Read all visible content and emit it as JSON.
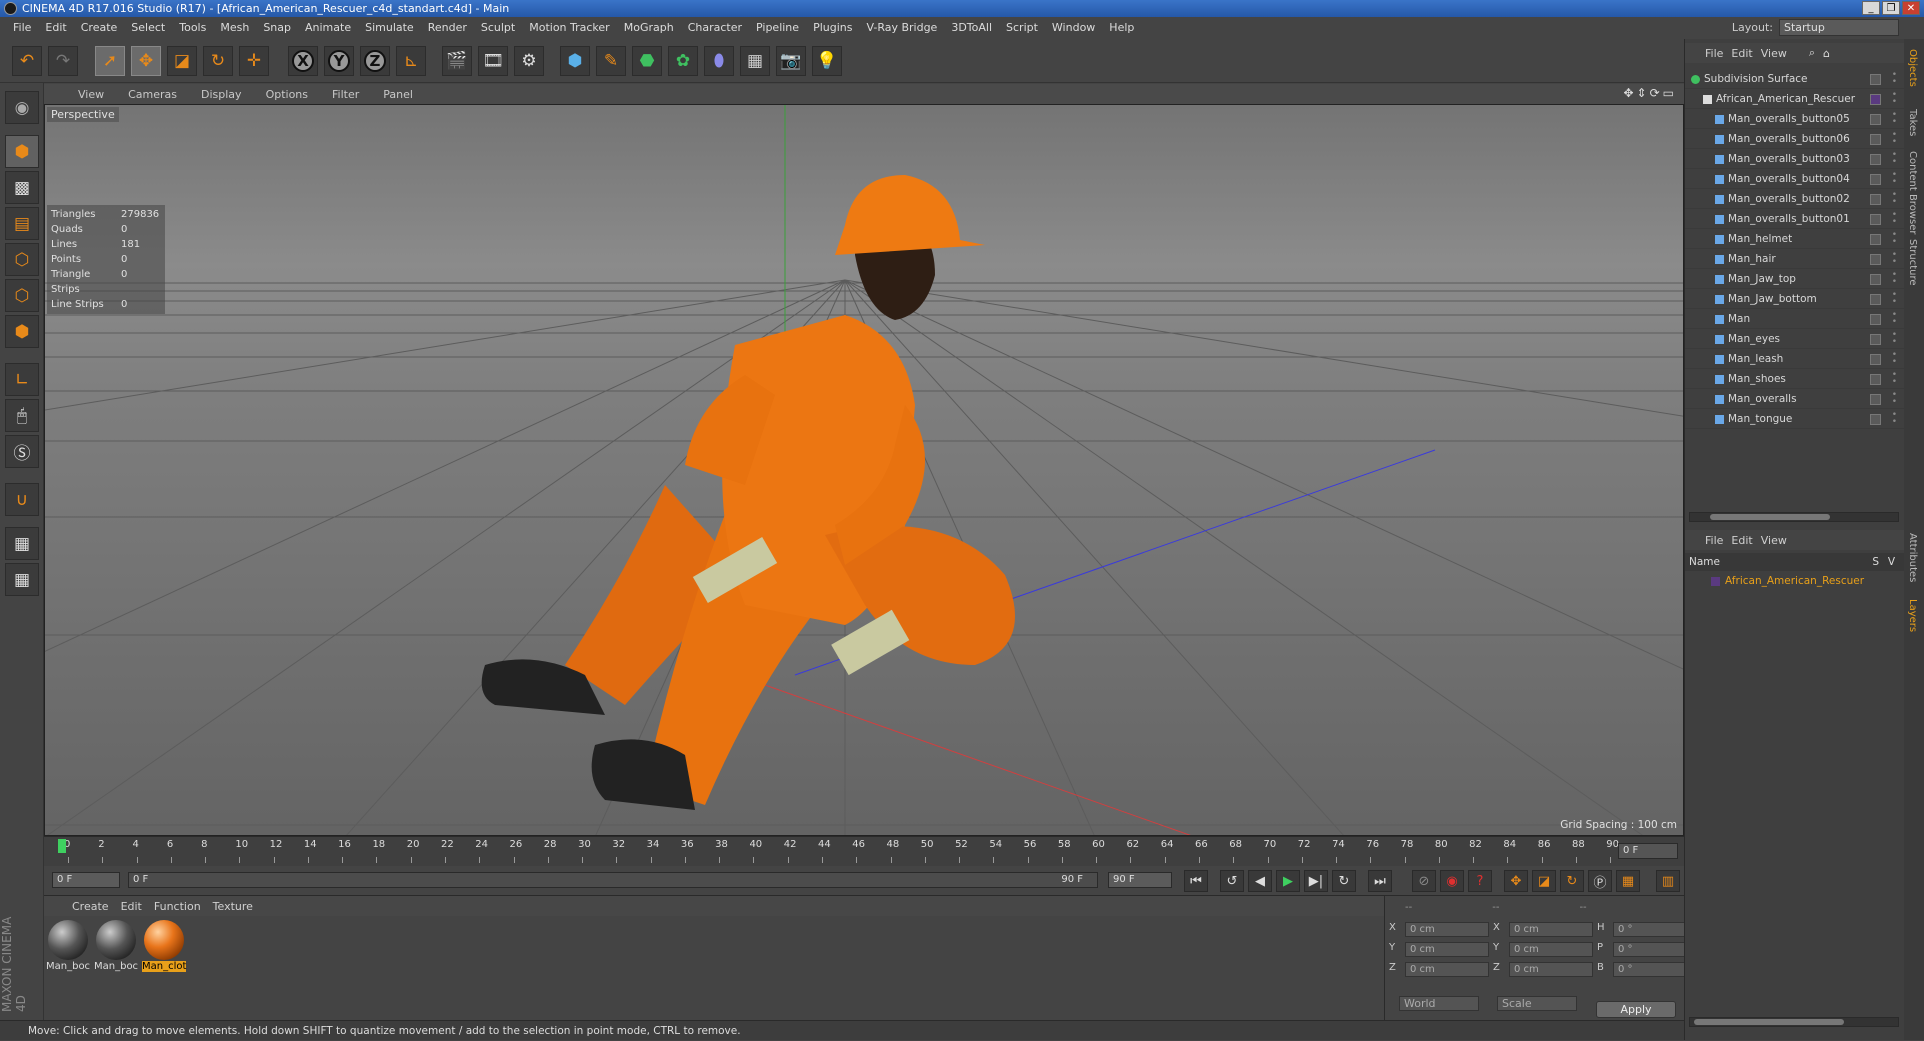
{
  "window": {
    "title": "CINEMA 4D R17.016 Studio (R17) - [African_American_Rescuer_c4d_standart.c4d] - Main"
  },
  "menubar": [
    "File",
    "Edit",
    "Create",
    "Select",
    "Tools",
    "Mesh",
    "Snap",
    "Animate",
    "Simulate",
    "Render",
    "Sculpt",
    "Motion Tracker",
    "MoGraph",
    "Character",
    "Pipeline",
    "Plugins",
    "V-Ray Bridge",
    "3DToAll",
    "Script",
    "Window",
    "Help"
  ],
  "layout": {
    "label": "Layout:",
    "value": "Startup"
  },
  "viewport": {
    "menu": [
      "View",
      "Cameras",
      "Display",
      "Options",
      "Filter",
      "Panel"
    ],
    "camera_label": "Perspective",
    "stats": [
      {
        "k": "Triangles",
        "v": "279836"
      },
      {
        "k": "Quads",
        "v": "0"
      },
      {
        "k": "Lines",
        "v": "181"
      },
      {
        "k": "Points",
        "v": "0"
      },
      {
        "k": "Triangle Strips",
        "v": "0"
      },
      {
        "k": "Line Strips",
        "v": "0"
      }
    ],
    "grid_spacing": "Grid Spacing : 100 cm"
  },
  "timeline": {
    "ticks": [
      "0",
      "2",
      "4",
      "6",
      "8",
      "10",
      "12",
      "14",
      "16",
      "18",
      "20",
      "22",
      "24",
      "26",
      "28",
      "30",
      "32",
      "34",
      "36",
      "38",
      "40",
      "42",
      "44",
      "46",
      "48",
      "50",
      "52",
      "54",
      "56",
      "58",
      "60",
      "62",
      "64",
      "66",
      "68",
      "70",
      "72",
      "74",
      "76",
      "78",
      "80",
      "82",
      "84",
      "86",
      "88",
      "90"
    ],
    "current_frame": "0 F",
    "start_frame": "0 F",
    "range_start": "0 F",
    "range_end": "90 F",
    "end_frame": "90 F"
  },
  "materials": {
    "menu": [
      "Create",
      "Edit",
      "Function",
      "Texture"
    ],
    "items": [
      {
        "label": "Man_boc",
        "selected": false
      },
      {
        "label": "Man_boc",
        "selected": false
      },
      {
        "label": "Man_clot",
        "selected": true
      }
    ]
  },
  "coords": {
    "headers": [
      "--",
      "--",
      "--"
    ],
    "rows": [
      {
        "a": "X",
        "av": "0 cm",
        "b": "X",
        "bv": "0 cm",
        "c": "H",
        "cv": "0 °"
      },
      {
        "a": "Y",
        "av": "0 cm",
        "b": "Y",
        "bv": "0 cm",
        "c": "P",
        "cv": "0 °"
      },
      {
        "a": "Z",
        "av": "0 cm",
        "b": "Z",
        "bv": "0 cm",
        "c": "B",
        "cv": "0 °"
      }
    ],
    "world": "World",
    "scale": "Scale",
    "apply": "Apply"
  },
  "statusbar": "Move: Click and drag to move elements. Hold down SHIFT to quantize movement / add to the selection in point mode, CTRL to remove.",
  "objects": {
    "menu": [
      "File",
      "Edit",
      "View"
    ],
    "items": [
      {
        "label": "Subdivision Surface",
        "indent": 0
      },
      {
        "label": "African_American_Rescuer",
        "indent": 1
      },
      {
        "label": "Man_overalls_button05",
        "indent": 2
      },
      {
        "label": "Man_overalls_button06",
        "indent": 2
      },
      {
        "label": "Man_overalls_button03",
        "indent": 2
      },
      {
        "label": "Man_overalls_button04",
        "indent": 2
      },
      {
        "label": "Man_overalls_button02",
        "indent": 2
      },
      {
        "label": "Man_overalls_button01",
        "indent": 2
      },
      {
        "label": "Man_helmet",
        "indent": 2
      },
      {
        "label": "Man_hair",
        "indent": 2
      },
      {
        "label": "Man_Jaw_top",
        "indent": 2
      },
      {
        "label": "Man_Jaw_bottom",
        "indent": 2
      },
      {
        "label": "Man",
        "indent": 2
      },
      {
        "label": "Man_eyes",
        "indent": 2
      },
      {
        "label": "Man_leash",
        "indent": 2
      },
      {
        "label": "Man_shoes",
        "indent": 2
      },
      {
        "label": "Man_overalls",
        "indent": 2
      },
      {
        "label": "Man_tongue",
        "indent": 2
      }
    ]
  },
  "layers": {
    "menu": [
      "File",
      "Edit",
      "View"
    ],
    "header_name": "Name",
    "header_s": "S",
    "header_v": "V",
    "row": "African_American_Rescuer"
  },
  "side_tabs": [
    "Objects",
    "Takes",
    "Content Browser",
    "Structure",
    "Attributes",
    "Layers"
  ],
  "maxon_brand": "MAXON CINEMA 4D",
  "colors": {
    "accent": "#e8a01a",
    "bg": "#444444",
    "title_bar": "#2f64b8"
  }
}
